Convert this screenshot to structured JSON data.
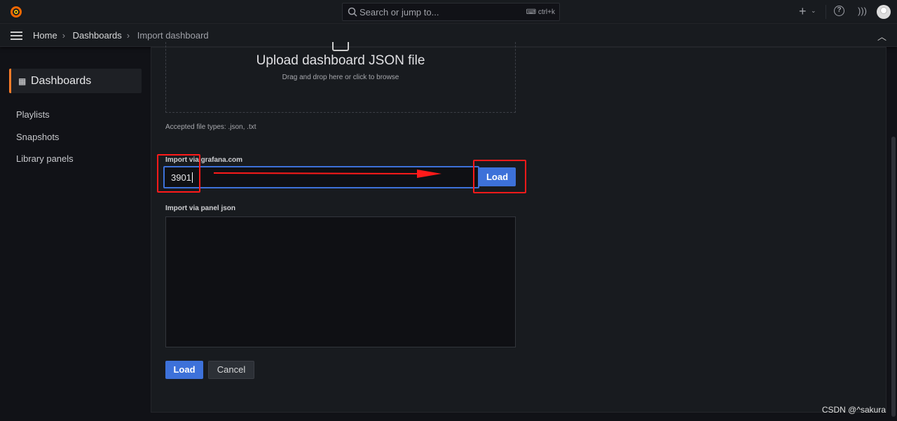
{
  "topbar": {
    "search_placeholder": "Search or jump to...",
    "shortcut": "ctrl+k",
    "icons": [
      "grafana-logo",
      "search-icon",
      "plus-icon",
      "chevron-down-icon",
      "help-icon",
      "rss-icon",
      "avatar"
    ]
  },
  "breadcrumb": {
    "items": [
      "Home",
      "Dashboards",
      "Import dashboard"
    ]
  },
  "sidebar": {
    "active": "Dashboards",
    "items": [
      "Playlists",
      "Snapshots",
      "Library panels"
    ]
  },
  "upload": {
    "title": "Upload dashboard JSON file",
    "subtitle": "Drag and drop here or click to browse",
    "accepted": "Accepted file types: .json, .txt"
  },
  "grafana_import": {
    "label": "Import via grafana.com",
    "value": "3901",
    "load": "Load"
  },
  "panel_json": {
    "label": "Import via panel json",
    "value": ""
  },
  "actions": {
    "load": "Load",
    "cancel": "Cancel"
  },
  "annotation_color": "#ff1a1a",
  "watermark": "CSDN @^sakura"
}
